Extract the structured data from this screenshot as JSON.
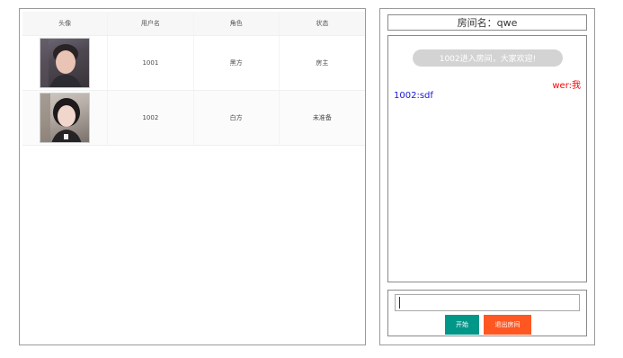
{
  "players_table": {
    "headers": [
      "头像",
      "用户名",
      "角色",
      "状态"
    ],
    "rows": [
      {
        "avatar": "user-avatar-photo",
        "username": "1001",
        "role": "黑方",
        "status": "房主"
      },
      {
        "avatar": "user-avatar-photo",
        "username": "1002",
        "role": "白方",
        "status": "未准备"
      }
    ]
  },
  "room": {
    "title": "房间名：qwe",
    "messages": {
      "system": "1002进入房间，大家欢迎!",
      "self": "wer:我",
      "other": "1002:sdf"
    },
    "input": {
      "value": "",
      "placeholder": ""
    },
    "buttons": {
      "start": "开始",
      "exit": "退出房间"
    }
  },
  "colors": {
    "start_button": "#009688",
    "exit_button": "#ff5722",
    "self_message": "#ff0000",
    "other_message": "#1a17d8",
    "system_bubble": "#d3d3d3"
  }
}
